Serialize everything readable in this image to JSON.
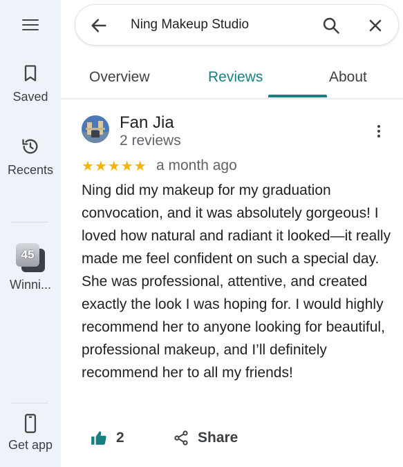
{
  "rail": {
    "saved_label": "Saved",
    "recents_label": "Recents",
    "recent_place": {
      "badge": "45",
      "label": "Winni..."
    },
    "get_app_label": "Get app"
  },
  "search": {
    "query": "Ning Makeup Studio"
  },
  "tabs": [
    "Overview",
    "Reviews",
    "About"
  ],
  "active_tab": "Reviews",
  "review": {
    "author": "Fan Jia",
    "author_meta": "2 reviews",
    "rating": 5,
    "stars_text": "★★★★★",
    "date": "a month ago",
    "text": "Ning did my makeup for my graduation convocation, and it was absolutely gorgeous! I loved how natural and radiant it looked—it really made me feel confident on such a special day. She was professional, attentive, and created exactly the look I was hoping for. I would highly recommend her to anyone looking for beautiful, professional makeup, and I’ll definitely recommend her to all my friends!",
    "likes": "2",
    "share_label": "Share"
  },
  "colors": {
    "accent": "#1a7f80",
    "rail_bg": "#eef3fa",
    "star": "#f6b400"
  }
}
